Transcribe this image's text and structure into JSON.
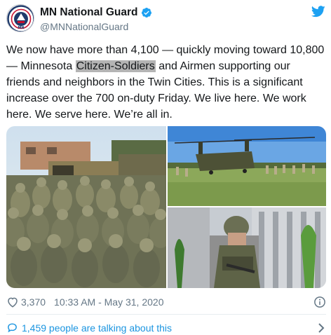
{
  "tweet": {
    "author": {
      "display_name": "MN National Guard",
      "handle": "@MNNationalGuard",
      "verified": true,
      "avatar_icon": "mn-national-guard-seal",
      "avatar_text": "MN"
    },
    "text_parts": [
      "We now have more than 4,100 — quickly moving toward 10,800 — Minnesota ",
      "Citizen-Soldiers",
      " and Airmen supporting our friends and neighbors in the Twin Cities. This is a significant increase over the 700 on-duty Friday. We live here. We work here. We serve here. We’re all in."
    ],
    "highlight_color": "#b4b4b4",
    "media": [
      {
        "icon": "photo-soldiers-crowd-with-trucks"
      },
      {
        "icon": "photo-chinook-helicopter-on-field"
      },
      {
        "icon": "photo-soldier-by-capitol-building"
      }
    ],
    "likes": "3,370",
    "timestamp": "10:33 AM - May 31, 2020",
    "talking": "1,459 people are talking about this"
  },
  "colors": {
    "text": "#14171a",
    "secondary": "#657786",
    "link": "#1b95e0",
    "verified": "#1da1f2",
    "divider": "#e6ecf0"
  },
  "icons": [
    "verified-badge-icon",
    "twitter-bird-icon",
    "heart-icon",
    "info-icon",
    "speech-bubble-icon",
    "chevron-right-icon"
  ]
}
